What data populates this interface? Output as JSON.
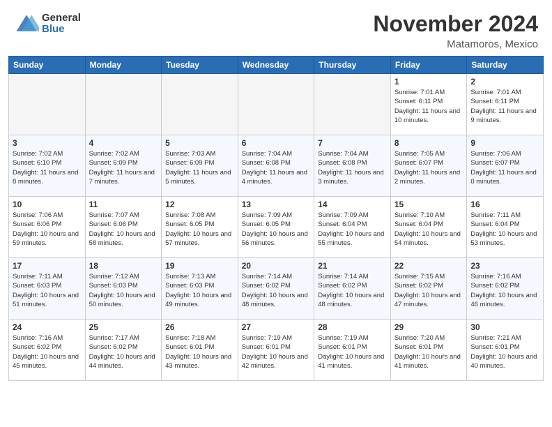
{
  "header": {
    "logo_general": "General",
    "logo_blue": "Blue",
    "month_title": "November 2024",
    "location": "Matamoros, Mexico"
  },
  "weekdays": [
    "Sunday",
    "Monday",
    "Tuesday",
    "Wednesday",
    "Thursday",
    "Friday",
    "Saturday"
  ],
  "weeks": [
    [
      {
        "day": "",
        "empty": true
      },
      {
        "day": "",
        "empty": true
      },
      {
        "day": "",
        "empty": true
      },
      {
        "day": "",
        "empty": true
      },
      {
        "day": "",
        "empty": true
      },
      {
        "day": "1",
        "sunrise": "7:01 AM",
        "sunset": "6:11 PM",
        "daylight": "11 hours and 10 minutes."
      },
      {
        "day": "2",
        "sunrise": "7:01 AM",
        "sunset": "6:11 PM",
        "daylight": "11 hours and 9 minutes."
      }
    ],
    [
      {
        "day": "3",
        "sunrise": "7:02 AM",
        "sunset": "6:10 PM",
        "daylight": "11 hours and 8 minutes."
      },
      {
        "day": "4",
        "sunrise": "7:02 AM",
        "sunset": "6:09 PM",
        "daylight": "11 hours and 7 minutes."
      },
      {
        "day": "5",
        "sunrise": "7:03 AM",
        "sunset": "6:09 PM",
        "daylight": "11 hours and 5 minutes."
      },
      {
        "day": "6",
        "sunrise": "7:04 AM",
        "sunset": "6:08 PM",
        "daylight": "11 hours and 4 minutes."
      },
      {
        "day": "7",
        "sunrise": "7:04 AM",
        "sunset": "6:08 PM",
        "daylight": "11 hours and 3 minutes."
      },
      {
        "day": "8",
        "sunrise": "7:05 AM",
        "sunset": "6:07 PM",
        "daylight": "11 hours and 2 minutes."
      },
      {
        "day": "9",
        "sunrise": "7:06 AM",
        "sunset": "6:07 PM",
        "daylight": "11 hours and 0 minutes."
      }
    ],
    [
      {
        "day": "10",
        "sunrise": "7:06 AM",
        "sunset": "6:06 PM",
        "daylight": "10 hours and 59 minutes."
      },
      {
        "day": "11",
        "sunrise": "7:07 AM",
        "sunset": "6:06 PM",
        "daylight": "10 hours and 58 minutes."
      },
      {
        "day": "12",
        "sunrise": "7:08 AM",
        "sunset": "6:05 PM",
        "daylight": "10 hours and 57 minutes."
      },
      {
        "day": "13",
        "sunrise": "7:09 AM",
        "sunset": "6:05 PM",
        "daylight": "10 hours and 56 minutes."
      },
      {
        "day": "14",
        "sunrise": "7:09 AM",
        "sunset": "6:04 PM",
        "daylight": "10 hours and 55 minutes."
      },
      {
        "day": "15",
        "sunrise": "7:10 AM",
        "sunset": "6:04 PM",
        "daylight": "10 hours and 54 minutes."
      },
      {
        "day": "16",
        "sunrise": "7:11 AM",
        "sunset": "6:04 PM",
        "daylight": "10 hours and 53 minutes."
      }
    ],
    [
      {
        "day": "17",
        "sunrise": "7:11 AM",
        "sunset": "6:03 PM",
        "daylight": "10 hours and 51 minutes."
      },
      {
        "day": "18",
        "sunrise": "7:12 AM",
        "sunset": "6:03 PM",
        "daylight": "10 hours and 50 minutes."
      },
      {
        "day": "19",
        "sunrise": "7:13 AM",
        "sunset": "6:03 PM",
        "daylight": "10 hours and 49 minutes."
      },
      {
        "day": "20",
        "sunrise": "7:14 AM",
        "sunset": "6:02 PM",
        "daylight": "10 hours and 48 minutes."
      },
      {
        "day": "21",
        "sunrise": "7:14 AM",
        "sunset": "6:02 PM",
        "daylight": "10 hours and 48 minutes."
      },
      {
        "day": "22",
        "sunrise": "7:15 AM",
        "sunset": "6:02 PM",
        "daylight": "10 hours and 47 minutes."
      },
      {
        "day": "23",
        "sunrise": "7:16 AM",
        "sunset": "6:02 PM",
        "daylight": "10 hours and 46 minutes."
      }
    ],
    [
      {
        "day": "24",
        "sunrise": "7:16 AM",
        "sunset": "6:02 PM",
        "daylight": "10 hours and 45 minutes."
      },
      {
        "day": "25",
        "sunrise": "7:17 AM",
        "sunset": "6:02 PM",
        "daylight": "10 hours and 44 minutes."
      },
      {
        "day": "26",
        "sunrise": "7:18 AM",
        "sunset": "6:01 PM",
        "daylight": "10 hours and 43 minutes."
      },
      {
        "day": "27",
        "sunrise": "7:19 AM",
        "sunset": "6:01 PM",
        "daylight": "10 hours and 42 minutes."
      },
      {
        "day": "28",
        "sunrise": "7:19 AM",
        "sunset": "6:01 PM",
        "daylight": "10 hours and 41 minutes."
      },
      {
        "day": "29",
        "sunrise": "7:20 AM",
        "sunset": "6:01 PM",
        "daylight": "10 hours and 41 minutes."
      },
      {
        "day": "30",
        "sunrise": "7:21 AM",
        "sunset": "6:01 PM",
        "daylight": "10 hours and 40 minutes."
      }
    ]
  ]
}
